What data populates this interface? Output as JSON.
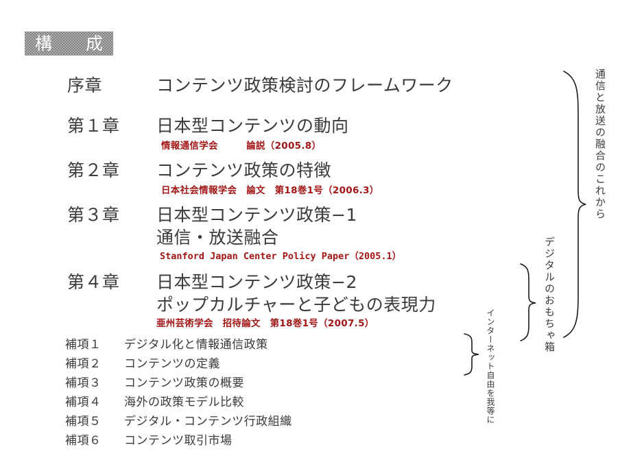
{
  "slide": {
    "title": "構　成",
    "title_icon": "section-banner"
  },
  "chapters": [
    {
      "label": "序章",
      "title": "コンテンツ政策検討のフレームワーク",
      "subtitle": "",
      "reference": ""
    },
    {
      "label": "第１章",
      "title": "日本型コンテンツの動向",
      "subtitle": "",
      "reference": "情報通信学会　　　論説（2005.8）"
    },
    {
      "label": "第２章",
      "title": "コンテンツ政策の特徴",
      "subtitle": "",
      "reference": "日本社会情報学会　論文　第18巻1号（2006.3）"
    },
    {
      "label": "第３章",
      "title": "日本型コンテンツ政策−1",
      "subtitle": "通信・放送融合",
      "reference": "Stanford Japan Center  Policy Paper（2005.1）"
    },
    {
      "label": "第４章",
      "title": "日本型コンテンツ政策−2",
      "subtitle": "ポップカルチャーと子どもの表現力",
      "reference": "亜州芸術学会　招待論文　第18巻1号（2007.5）"
    }
  ],
  "appendices": [
    {
      "label": "補項１",
      "text": "デジタル化と情報通信政策"
    },
    {
      "label": "補項２",
      "text": "コンテンツの定義"
    },
    {
      "label": "補項３",
      "text": "コンテンツ政策の概要"
    },
    {
      "label": "補項４",
      "text": "海外の政策モデル比較"
    },
    {
      "label": "補項５",
      "text": "デジタル・コンテンツ行政組織"
    },
    {
      "label": "補項６",
      "text": "コンテンツ取引市場"
    }
  ],
  "vertical_annotations": [
    {
      "text": "通信と放送の融合のこれから"
    },
    {
      "text": "デジタルのおもちゃ箱"
    },
    {
      "text": "インターネット自由を我等に"
    }
  ],
  "colors": {
    "text": "#3a3a3a",
    "reference": "#a31515",
    "banner_background": "#808080",
    "banner_text": "#ffffff",
    "brace": "#1a1a1a",
    "page_background": "#ffffff"
  }
}
